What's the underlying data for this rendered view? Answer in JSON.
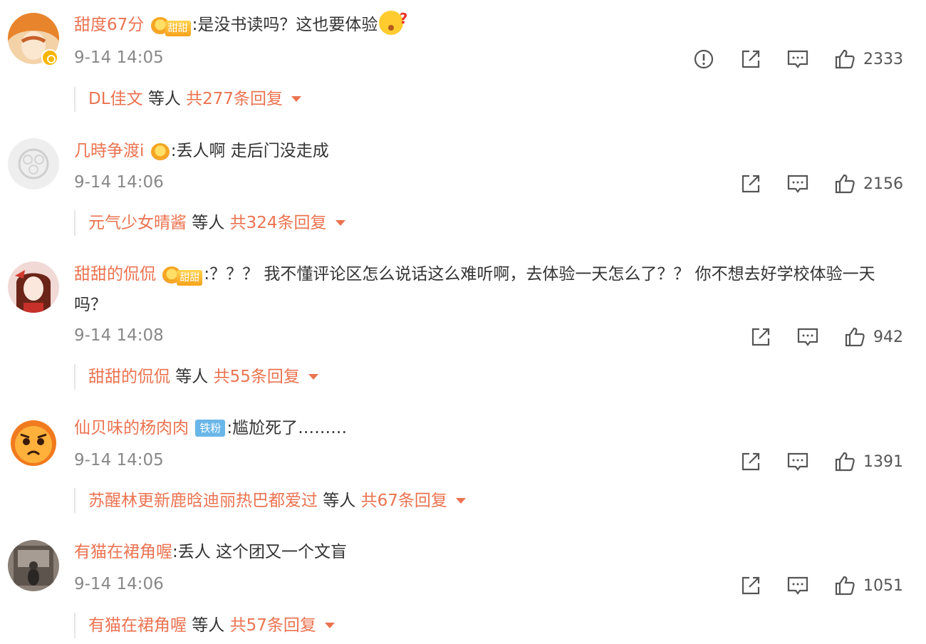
{
  "comments": [
    {
      "username": "甜度67分",
      "separator": ":",
      "text": "是没书读吗？这也要体验",
      "badge_text": "甜甜",
      "time": "9-14 14:05",
      "likes": "2333",
      "reply_user": "DL佳文",
      "reply_mid": " 等人 ",
      "reply_count": "共277条回复"
    },
    {
      "username": "几時争渡i",
      "separator": ":",
      "text": "丢人啊 走后门没走成",
      "time": "9-14 14:06",
      "likes": "2156",
      "reply_user": "元气少女晴酱",
      "reply_mid": " 等人 ",
      "reply_count": "共324条回复"
    },
    {
      "username": "甜甜的侃侃",
      "separator": ":",
      "text": "？？？ 我不懂评论区怎么说话这么难听啊，去体验一天怎么了？？ 你不想去好学校体验一天吗？",
      "badge_text": "甜甜",
      "time": "9-14 14:08",
      "likes": "942",
      "reply_user": "甜甜的侃侃",
      "reply_mid": " 等人 ",
      "reply_count": "共55条回复"
    },
    {
      "username": "仙贝味的杨肉肉",
      "separator": ":",
      "text": "尴尬死了………",
      "badge_text": "铁粉",
      "time": "9-14 14:05",
      "likes": "1391",
      "reply_user": "苏醒林更新鹿晗迪丽热巴都爱过",
      "reply_mid": " 等人 ",
      "reply_count": "共67条回复"
    },
    {
      "username": "有猫在裙角喔",
      "separator": ":",
      "text": "丢人 这个团又一个文盲",
      "time": "9-14 14:06",
      "likes": "1051",
      "reply_user": "有猫在裙角喔",
      "reply_mid": " 等人 ",
      "reply_count": "共57条回复"
    }
  ],
  "icons": {
    "report": "exclamation-circle-icon",
    "share": "share-icon",
    "comment": "comment-icon",
    "like": "thumbs-up-icon",
    "expand": "caret-down-icon"
  },
  "colors": {
    "username": "#eb7350",
    "text": "#333333",
    "time": "#888888"
  }
}
